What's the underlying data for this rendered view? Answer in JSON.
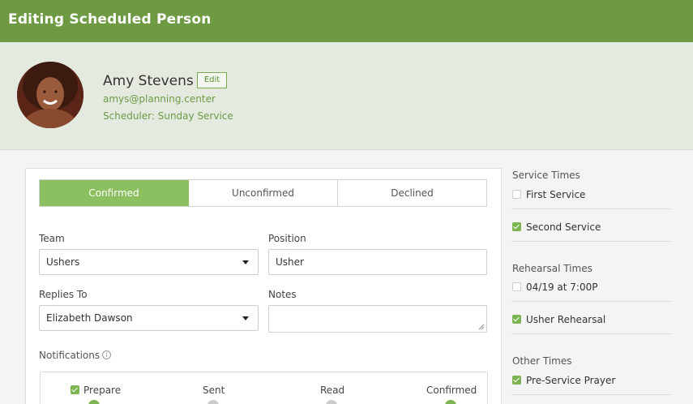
{
  "header": {
    "title": "Editing Scheduled Person"
  },
  "person": {
    "name": "Amy Stevens",
    "edit_label": "Edit",
    "email": "amys@planning.center",
    "scheduler": "Scheduler: Sunday Service"
  },
  "status_tabs": [
    {
      "label": "Confirmed",
      "active": true
    },
    {
      "label": "Unconfirmed",
      "active": false
    },
    {
      "label": "Declined",
      "active": false
    }
  ],
  "form": {
    "team_label": "Team",
    "team_value": "Ushers",
    "position_label": "Position",
    "position_value": "Usher",
    "replies_label": "Replies To",
    "replies_value": "Elizabeth Dawson",
    "notes_label": "Notes",
    "notes_value": ""
  },
  "notifications": {
    "label": "Notifications",
    "info_glyph": "i",
    "columns": [
      {
        "label": "Prepare",
        "checked": true
      },
      {
        "label": "Sent"
      },
      {
        "label": "Read"
      },
      {
        "label": "Confirmed"
      }
    ],
    "colors": {
      "green": "#7cb452",
      "grey": "#cccccc"
    }
  },
  "sidebar": {
    "service_times_label": "Service Times",
    "service_times": [
      {
        "label": "First Service",
        "checked": false
      },
      {
        "label": "Second Service",
        "checked": true
      }
    ],
    "rehearsal_times_label": "Rehearsal Times",
    "rehearsal_times": [
      {
        "label": "04/19 at 7:00P",
        "checked": false
      },
      {
        "label": "Usher Rehearsal",
        "checked": true
      }
    ],
    "other_times_label": "Other Times",
    "other_times": [
      {
        "label": "Pre-Service Prayer",
        "checked": true
      }
    ]
  },
  "colors": {
    "header_green": "#6e9a44",
    "active_tab": "#8bbf5f",
    "profile_bg": "#e4eadf",
    "link_green": "#6e9a44"
  }
}
